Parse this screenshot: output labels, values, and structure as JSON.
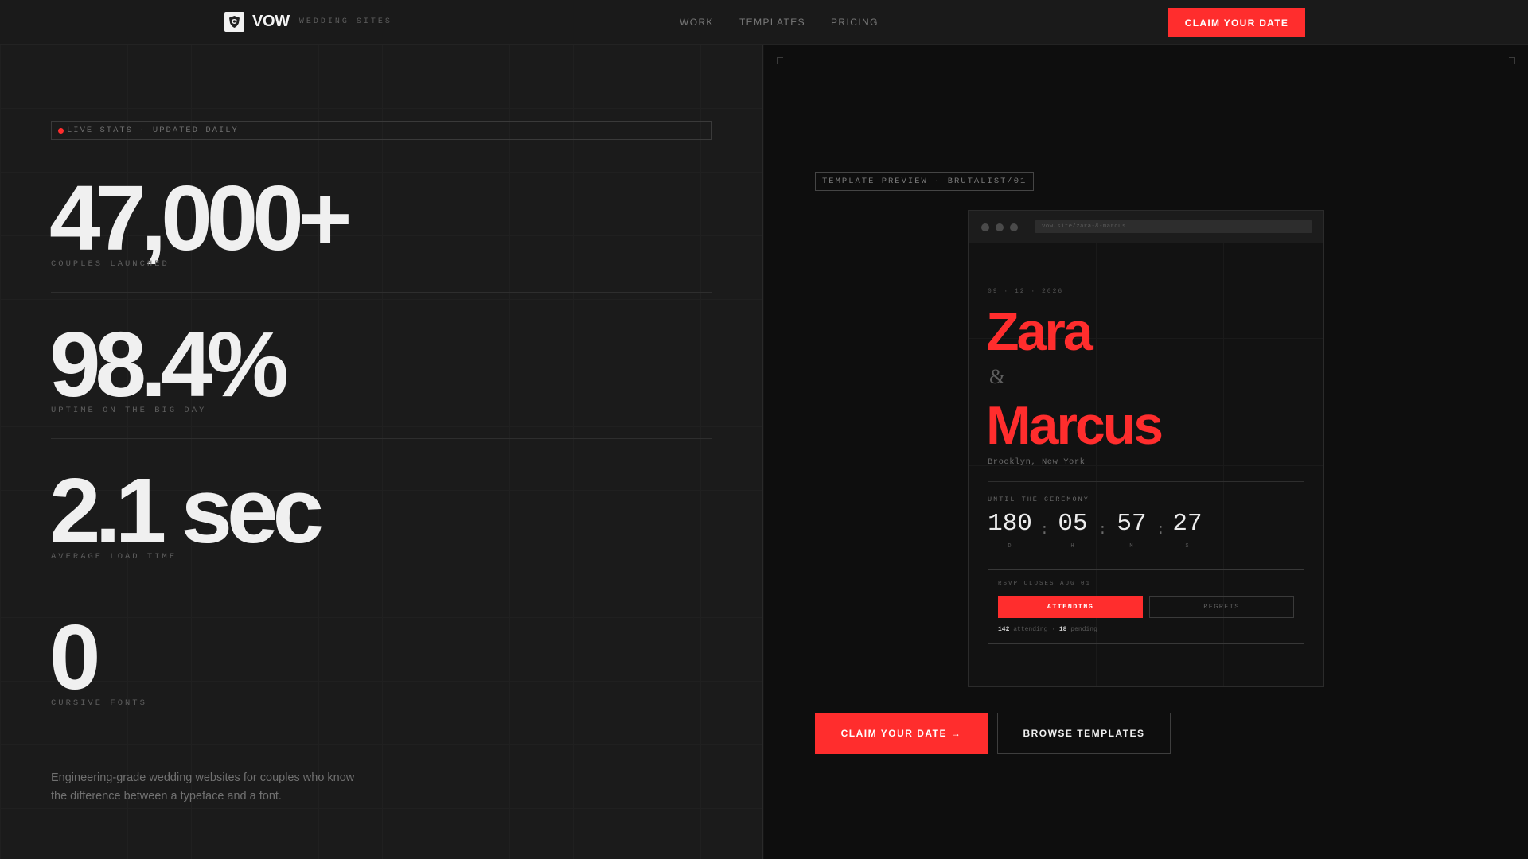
{
  "header": {
    "brand": "VOW",
    "brand_sub": "WEDDING SITES",
    "nav": [
      {
        "label": "WORK"
      },
      {
        "label": "TEMPLATES"
      },
      {
        "label": "PRICING"
      }
    ],
    "cta": "CLAIM YOUR DATE"
  },
  "stats": {
    "badge": "LIVE STATS · UPDATED DAILY",
    "items": [
      {
        "value": "47,000+",
        "label": "COUPLES LAUNCHED"
      },
      {
        "value": "98.4%",
        "label": "UPTIME ON THE BIG DAY"
      },
      {
        "value": "2.1 sec",
        "label": "AVERAGE LOAD TIME"
      },
      {
        "value": "0",
        "label": "CURSIVE FONTS"
      }
    ],
    "description": "Engineering-grade wedding websites for couples who know the difference between a typeface and a font."
  },
  "preview": {
    "badge": "TEMPLATE PREVIEW · BRUTALIST/01",
    "url": "vow.site/zara-&-marcus",
    "date": "09 · 12 · 2026",
    "name1": "Zara",
    "amp": "&",
    "name2": "Marcus",
    "location": "Brooklyn, New York",
    "until": "UNTIL THE CEREMONY",
    "countdown": [
      {
        "value": "180",
        "unit": "D"
      },
      {
        "value": "05",
        "unit": "H"
      },
      {
        "value": "57",
        "unit": "M"
      },
      {
        "value": "27",
        "unit": "S"
      }
    ],
    "separator": ":",
    "rsvp": {
      "label": "RSVP CLOSES AUG 01",
      "attending": "ATTENDING",
      "regrets": "REGRETS",
      "attending_count": "142",
      "attending_word": "attending",
      "dot": "·",
      "pending_count": "18",
      "pending_word": "pending"
    }
  },
  "cta": {
    "primary": "CLAIM YOUR DATE →",
    "secondary": "BROWSE TEMPLATES"
  },
  "colors": {
    "accent": "#ff2d2d",
    "bg_left": "#1b1b1b",
    "bg_right": "#0e0e0e"
  }
}
